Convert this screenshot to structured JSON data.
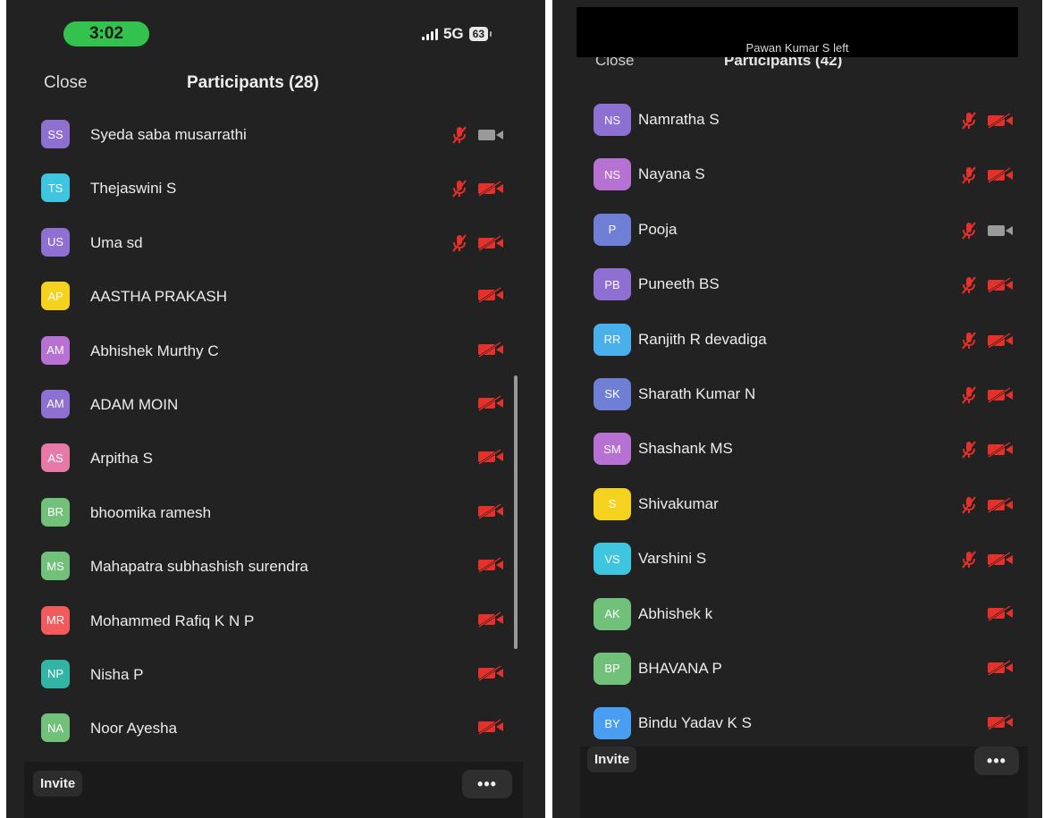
{
  "left": {
    "status": {
      "time": "3:02",
      "network": "5G",
      "battery": "63"
    },
    "header": {
      "close_label": "Close",
      "title": "Participants (28)"
    },
    "participants": [
      {
        "initials": "SS",
        "name": "Syeda saba musarrathi",
        "color": "#8e6fd2",
        "mic_muted": true,
        "video": "on"
      },
      {
        "initials": "TS",
        "name": "Thejaswini S",
        "color": "#3ec6e0",
        "mic_muted": true,
        "video": "off"
      },
      {
        "initials": "US",
        "name": "Uma sd",
        "color": "#8e6fd2",
        "mic_muted": true,
        "video": "off"
      },
      {
        "initials": "AP",
        "name": "AASTHA PRAKASH",
        "color": "#f4d21d",
        "mic_muted": false,
        "video": "off"
      },
      {
        "initials": "AM",
        "name": "Abhishek Murthy C",
        "color": "#b771d2",
        "mic_muted": false,
        "video": "off"
      },
      {
        "initials": "AM",
        "name": "ADAM MOIN",
        "color": "#8e6fd2",
        "mic_muted": false,
        "video": "off"
      },
      {
        "initials": "AS",
        "name": "Arpitha S",
        "color": "#e57aa8",
        "mic_muted": false,
        "video": "off"
      },
      {
        "initials": "BR",
        "name": "bhoomika ramesh",
        "color": "#72c17a",
        "mic_muted": false,
        "video": "off"
      },
      {
        "initials": "MS",
        "name": "Mahapatra subhashish surendra",
        "color": "#72c17a",
        "mic_muted": false,
        "video": "off"
      },
      {
        "initials": "MR",
        "name": "Mohammed Rafiq K N P",
        "color": "#f25b5b",
        "mic_muted": false,
        "video": "off"
      },
      {
        "initials": "NP",
        "name": "Nisha P",
        "color": "#33b5a6",
        "mic_muted": false,
        "video": "off"
      },
      {
        "initials": "NA",
        "name": "Noor Ayesha",
        "color": "#72c17a",
        "mic_muted": false,
        "video": "off"
      }
    ],
    "footer": {
      "invite_label": "Invite",
      "more_label": "•••"
    }
  },
  "right": {
    "banner": "Pawan Kumar S left",
    "header": {
      "close_label": "Close",
      "title": "Participants (42)"
    },
    "participants": [
      {
        "initials": "NS",
        "name": "Namratha S",
        "color": "#8e6fd2",
        "mic_muted": true,
        "video": "off"
      },
      {
        "initials": "NS",
        "name": "Nayana S",
        "color": "#b771d2",
        "mic_muted": true,
        "video": "off"
      },
      {
        "initials": "P",
        "name": "Pooja",
        "color": "#6f7fd6",
        "mic_muted": true,
        "video": "on"
      },
      {
        "initials": "PB",
        "name": "Puneeth BS",
        "color": "#8e6fd2",
        "mic_muted": true,
        "video": "off"
      },
      {
        "initials": "RR",
        "name": "Ranjith R devadiga",
        "color": "#4ab0ec",
        "mic_muted": true,
        "video": "off"
      },
      {
        "initials": "SK",
        "name": "Sharath Kumar N",
        "color": "#6f7fd6",
        "mic_muted": true,
        "video": "off"
      },
      {
        "initials": "SM",
        "name": "Shashank MS",
        "color": "#b771d2",
        "mic_muted": true,
        "video": "off"
      },
      {
        "initials": "S",
        "name": "Shivakumar",
        "color": "#f4d21d",
        "mic_muted": true,
        "video": "off"
      },
      {
        "initials": "VS",
        "name": "Varshini S",
        "color": "#3ec6e0",
        "mic_muted": true,
        "video": "off"
      },
      {
        "initials": "AK",
        "name": "Abhishek k",
        "color": "#72c17a",
        "mic_muted": false,
        "video": "off"
      },
      {
        "initials": "BP",
        "name": "BHAVANA P",
        "color": "#72c17a",
        "mic_muted": false,
        "video": "off"
      },
      {
        "initials": "BY",
        "name": "Bindu Yadav K S",
        "color": "#4a9ef2",
        "mic_muted": false,
        "video": "off"
      }
    ],
    "footer": {
      "invite_label": "Invite",
      "more_label": "•••"
    }
  },
  "colors": {
    "muted_red": "#e8302a",
    "video_on_gray": "#9a9a9a",
    "background": "#222222"
  }
}
